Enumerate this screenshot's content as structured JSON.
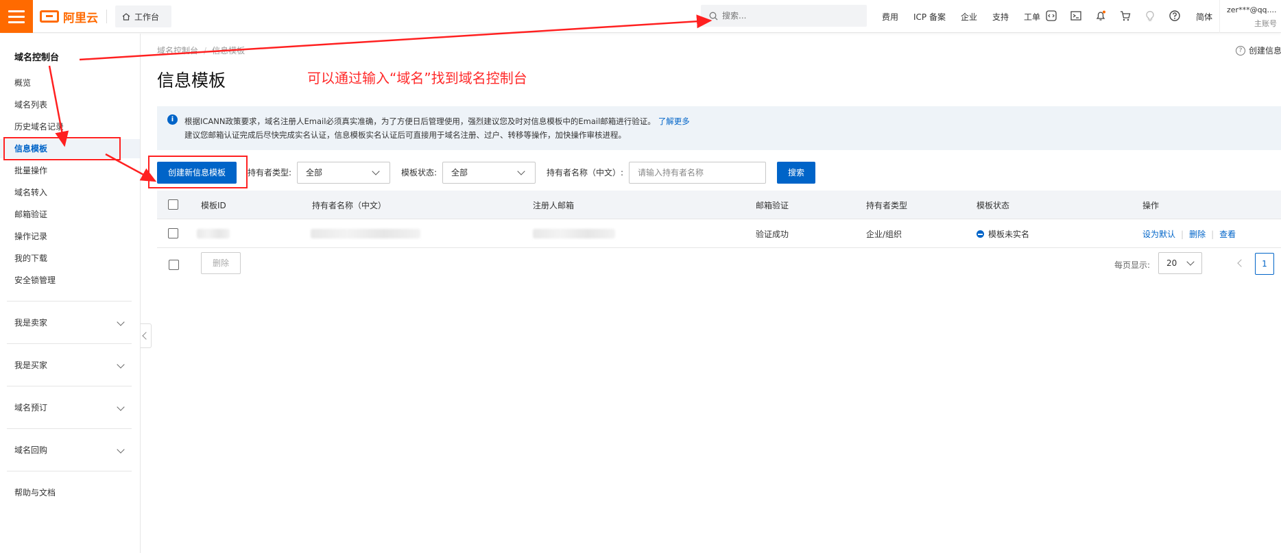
{
  "topbar": {
    "logo_text": "阿里云",
    "workbench_label": "工作台",
    "search_placeholder": "搜索...",
    "nav": [
      "费用",
      "ICP 备案",
      "企业",
      "支持",
      "工单"
    ],
    "icons": [
      "code-icon",
      "terminal-icon",
      "bell-icon",
      "cart-icon",
      "bulb-icon",
      "help-icon"
    ],
    "language": "简体",
    "account_name": "zer***@qq....",
    "account_role": "主账号"
  },
  "sidebar": {
    "title": "域名控制台",
    "items": [
      {
        "label": "概览"
      },
      {
        "label": "域名列表"
      },
      {
        "label": "历史域名记录"
      },
      {
        "label": "信息模板"
      },
      {
        "label": "批量操作"
      },
      {
        "label": "域名转入"
      },
      {
        "label": "邮箱验证"
      },
      {
        "label": "操作记录"
      },
      {
        "label": "我的下载"
      },
      {
        "label": "安全锁管理"
      }
    ],
    "active_index": 3,
    "groups": [
      {
        "label": "我是卖家"
      },
      {
        "label": "我是买家"
      },
      {
        "label": "域名预订"
      },
      {
        "label": "域名回购"
      }
    ],
    "help": "帮助与文档"
  },
  "main": {
    "breadcrumb": [
      "域名控制台",
      "信息模板"
    ],
    "help_link": "创建信息模板",
    "title": "信息模板",
    "annotation": "可以通过输入“域名”找到域名控制台",
    "notice": {
      "line1": "根据ICANN政策要求，域名注册人Email必须真实准确，为了方便日后管理使用，强烈建议您及时对信息模板中的Email邮箱进行验证。",
      "link": "了解更多",
      "line2": "建议您邮箱认证完成后尽快完成实名认证，信息模板实名认证后可直接用于域名注册、过户、转移等操作，加快操作审核进程。"
    },
    "create_button": "创建新信息模板",
    "filters": {
      "owner_type_label": "持有者类型:",
      "owner_type_value": "全部",
      "status_label": "模板状态:",
      "status_value": "全部",
      "owner_name_label": "持有者名称（中文）:",
      "owner_name_placeholder": "请输入持有者名称",
      "search_button": "搜索"
    },
    "table": {
      "headers": [
        "模板ID",
        "持有者名称（中文）",
        "注册人邮箱",
        "邮箱验证",
        "持有者类型",
        "模板状态",
        "操作"
      ],
      "rows": [
        {
          "email_verify": "验证成功",
          "owner_type": "企业/组织",
          "status": "模板未实名",
          "ops": [
            "设为默认",
            "删除",
            "查看"
          ]
        }
      ]
    },
    "footer": {
      "delete_button": "删除",
      "page_size_label": "每页显示:",
      "page_size": "20",
      "current_page": "1"
    }
  },
  "colors": {
    "brand": "#ff6a00",
    "primary": "#0064c8",
    "annotation": "#ff2020"
  }
}
